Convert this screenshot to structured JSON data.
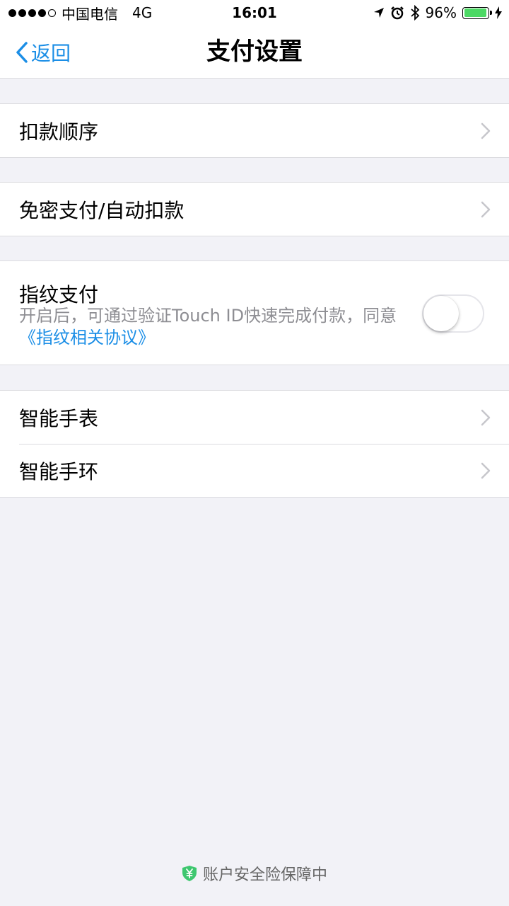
{
  "status_bar": {
    "signal_bars": 4,
    "signal_max": 5,
    "carrier": "中国电信",
    "network": "4G",
    "time": "16:01",
    "battery_percent_label": "96%",
    "battery_level": 0.96,
    "icons": [
      "location-icon",
      "alarm-icon",
      "bluetooth-icon",
      "battery-icon",
      "charging-icon"
    ]
  },
  "nav": {
    "back_label": "返回",
    "title": "支付设置"
  },
  "menu": {
    "deduction_order": "扣款顺序",
    "password_free": "免密支付/自动扣款",
    "smart_watch": "智能手表",
    "smart_band": "智能手环"
  },
  "fingerprint": {
    "title": "指纹支付",
    "desc": "开启后，可通过验证Touch ID快速完成付款，同意",
    "agreement_link": "《指纹相关协议》",
    "enabled": false
  },
  "footer": {
    "text": "账户安全险保障中",
    "icon": "shield-yuan-icon",
    "icon_color": "#3ec76f"
  },
  "colors": {
    "accent": "#1b8ee6",
    "background": "#f2f2f7"
  }
}
